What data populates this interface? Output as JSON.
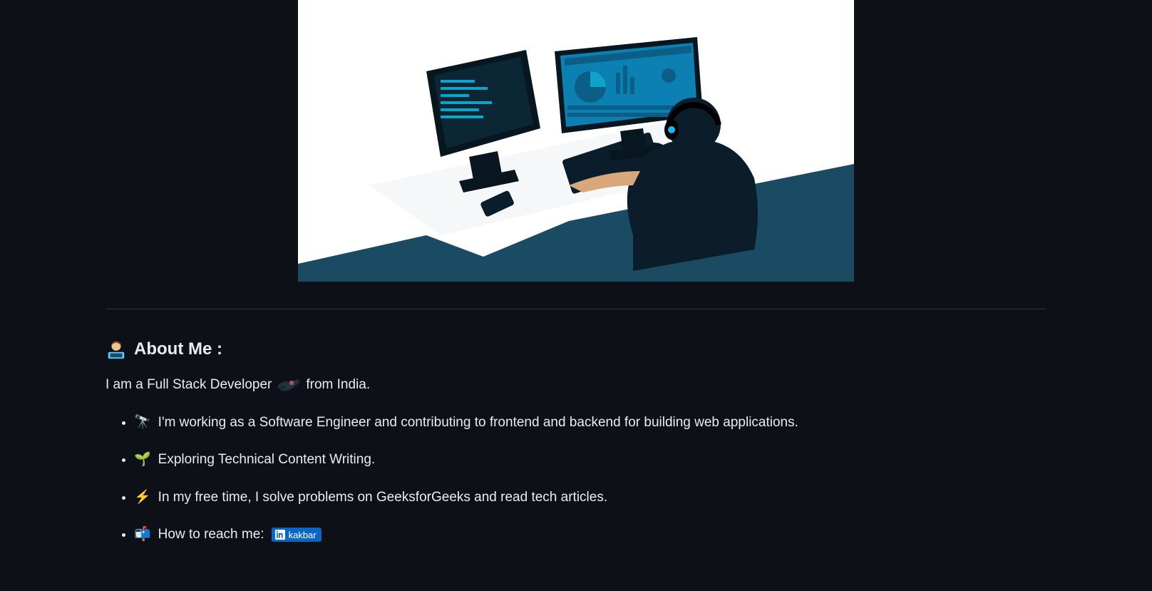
{
  "about": {
    "heading_text": "About Me :",
    "intro_prefix": "I am a Full Stack Developer",
    "intro_suffix": "from India."
  },
  "list": {
    "items": [
      {
        "emoji": "🔭",
        "text": "I'm working as a Software Engineer and contributing to frontend and backend for building web applications."
      },
      {
        "emoji": "🌱",
        "text": "Exploring Technical Content Writing."
      },
      {
        "emoji": "⚡",
        "text": "In my free time, I solve problems on GeeksforGeeks and read tech articles."
      }
    ],
    "contact": {
      "emoji": "📬",
      "label": "How to reach me:",
      "badge_text": "kakbar"
    }
  }
}
